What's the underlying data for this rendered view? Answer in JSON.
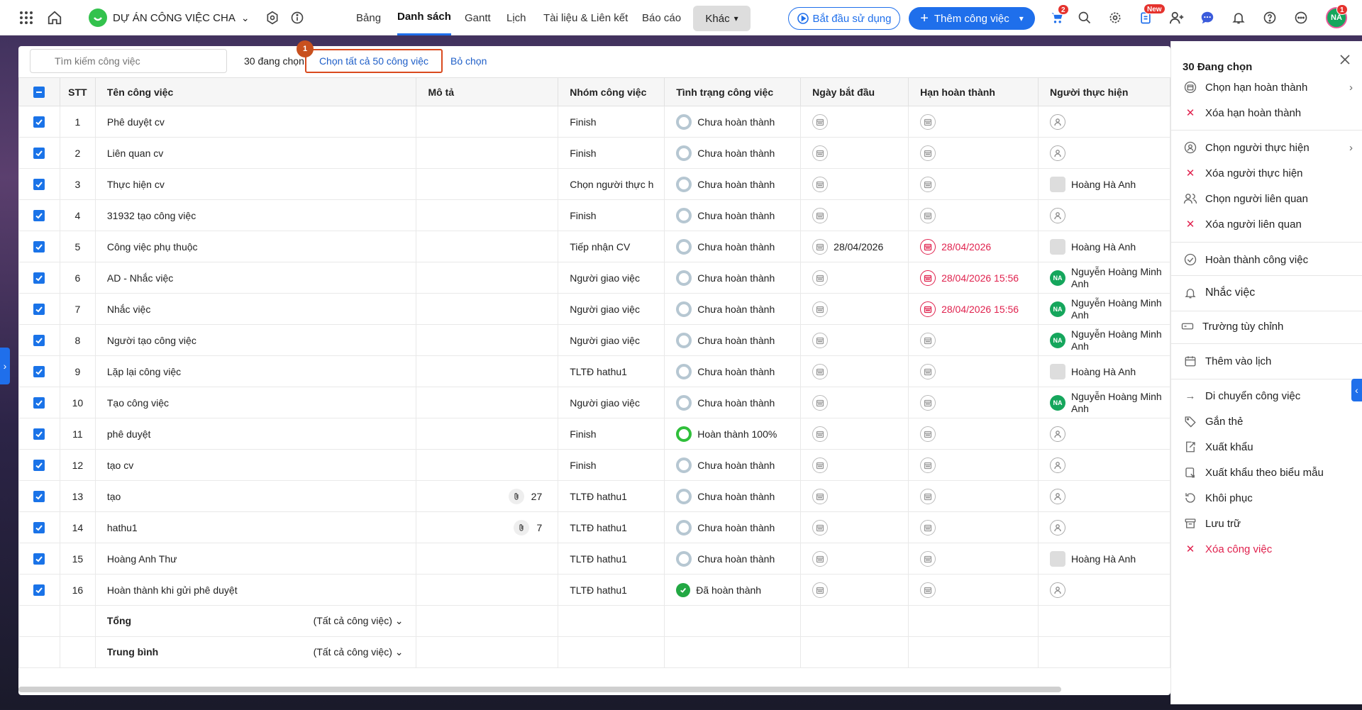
{
  "topbar": {
    "project_name": "DỰ ÁN CÔNG VIỆC CHA",
    "nav": [
      "Bảng",
      "Danh sách",
      "Gantt",
      "Lịch",
      "Tài liệu & Liên kết",
      "Báo cáo"
    ],
    "nav_more": "Khác",
    "start_label": "Bắt đầu sử dụng",
    "add_label": "Thêm công việc",
    "cart_badge": "2",
    "new_badge": "New",
    "avatar_initials": "NA",
    "avatar_badge": "1"
  },
  "toolbar": {
    "search_placeholder": "Tìm kiếm công việc",
    "selected_count": "30 đang chọn",
    "select_all": "Chọn tất cả 50 công việc",
    "step_number": "1",
    "deselect": "Bỏ chọn"
  },
  "table": {
    "headers": [
      "STT",
      "Tên công việc",
      "Mô tả",
      "Nhóm công việc",
      "Tình trạng công việc",
      "Ngày bắt đầu",
      "Hạn hoàn thành",
      "Người thực hiện"
    ],
    "rows": [
      {
        "stt": "1",
        "name": "Phê duyệt cv",
        "group": "Finish",
        "status": "Chưa hoàn thành"
      },
      {
        "stt": "2",
        "name": "Liên quan cv",
        "group": "Finish",
        "status": "Chưa hoàn thành"
      },
      {
        "stt": "3",
        "name": "Thực hiện cv",
        "group": "Chọn người thực h",
        "status": "Chưa hoàn thành",
        "assignee": "Hoàng Hà Anh"
      },
      {
        "stt": "4",
        "name": "31932 tạo công việc",
        "group": "Finish",
        "status": "Chưa hoàn thành"
      },
      {
        "stt": "5",
        "name": "Công việc phụ thuộc",
        "group": "Tiếp nhận CV",
        "status": "Chưa hoàn thành",
        "start": "28/04/2026",
        "due": "28/04/2026",
        "assignee": "Hoàng Hà Anh"
      },
      {
        "stt": "6",
        "name": "AD - Nhắc việc",
        "group": "Người giao việc",
        "status": "Chưa hoàn thành",
        "due": "28/04/2026 15:56",
        "assignee_l1": "Nguyễn Hoàng Minh",
        "assignee_l2": "Anh"
      },
      {
        "stt": "7",
        "name": "Nhắc việc",
        "group": "Người giao việc",
        "status": "Chưa hoàn thành",
        "due": "28/04/2026 15:56",
        "assignee_l1": "Nguyễn Hoàng Minh",
        "assignee_l2": "Anh"
      },
      {
        "stt": "8",
        "name": "Người tạo công việc",
        "group": "Người giao việc",
        "status": "Chưa hoàn thành",
        "assignee_l1": "Nguyễn Hoàng Minh",
        "assignee_l2": "Anh"
      },
      {
        "stt": "9",
        "name": "Lặp lại công việc",
        "group": "TLTĐ hathu1",
        "status": "Chưa hoàn thành",
        "assignee": "Hoàng Hà Anh"
      },
      {
        "stt": "10",
        "name": "Tạo công việc",
        "group": "Người giao việc",
        "status": "Chưa hoàn thành",
        "assignee_l1": "Nguyễn Hoàng Minh",
        "assignee_l2": "Anh"
      },
      {
        "stt": "11",
        "name": "phê duyệt",
        "group": "Finish",
        "status": "Hoàn thành 100%"
      },
      {
        "stt": "12",
        "name": "tạo cv",
        "group": "Finish",
        "status": "Chưa hoàn thành"
      },
      {
        "stt": "13",
        "name": "tạo",
        "desc_count": "27",
        "group": "TLTĐ hathu1",
        "status": "Chưa hoàn thành"
      },
      {
        "stt": "14",
        "name": "hathu1",
        "desc_count": "7",
        "group": "TLTĐ hathu1",
        "status": "Chưa hoàn thành"
      },
      {
        "stt": "15",
        "name": "Hoàng Anh Thư",
        "group": "TLTĐ hathu1",
        "status": "Chưa hoàn thành",
        "assignee": "Hoàng Hà Anh"
      },
      {
        "stt": "16",
        "name": "Hoàn thành khi gửi phê duyệt",
        "group": "TLTĐ hathu1",
        "status": "Đã hoàn thành"
      }
    ],
    "footer_total": "Tổng",
    "footer_avg": "Trung bình",
    "footer_scope": "(Tất cả công việc)"
  },
  "panel": {
    "title": "30 Đang chọn",
    "items": [
      "Chọn hạn hoàn thành",
      "Xóa hạn hoàn thành",
      "Chọn người thực hiện",
      "Xóa người thực hiện",
      "Chọn người liên quan",
      "Xóa người liên quan",
      "Hoàn thành công việc",
      "Nhắc việc",
      "Trường tùy chỉnh",
      "Thêm vào lịch",
      "Di chuyển công việc",
      "Gắn thẻ",
      "Xuất khẩu",
      "Xuất khẩu theo biểu mẫu",
      "Khôi phục",
      "Lưu trữ",
      "Xóa công việc"
    ]
  },
  "colors": {
    "accent": "#1f6feb",
    "danger": "#e0224e",
    "success": "#22a843"
  }
}
